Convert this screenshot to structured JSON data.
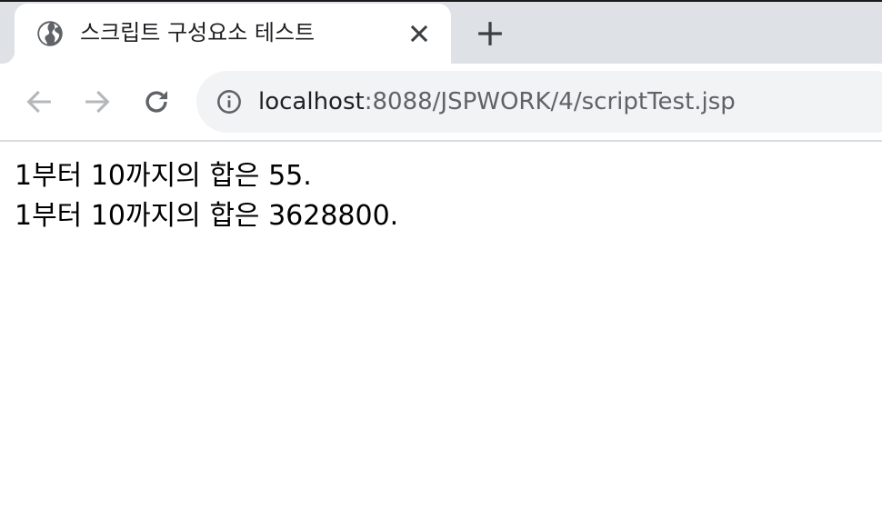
{
  "tab": {
    "title": "스크립트 구성요소 테스트",
    "favicon": "globe-icon",
    "close_icon": "close-icon"
  },
  "new_tab_icon": "plus-icon",
  "toolbar": {
    "back_icon": "arrow-left-icon",
    "forward_icon": "arrow-right-icon",
    "reload_icon": "reload-icon",
    "info_icon": "info-icon"
  },
  "address_bar": {
    "host": "localhost",
    "rest": ":8088/JSPWORK/4/scriptTest.jsp"
  },
  "content": {
    "lines": [
      "1부터 10까지의 합은 55.",
      "1부터 10까지의 합은 3628800."
    ]
  },
  "colors": {
    "tabstrip": "#dee1e6",
    "omnibox": "#f1f3f4",
    "icon": "#5f6368",
    "icon_disabled": "#b5b7ba",
    "text": "#202124"
  }
}
